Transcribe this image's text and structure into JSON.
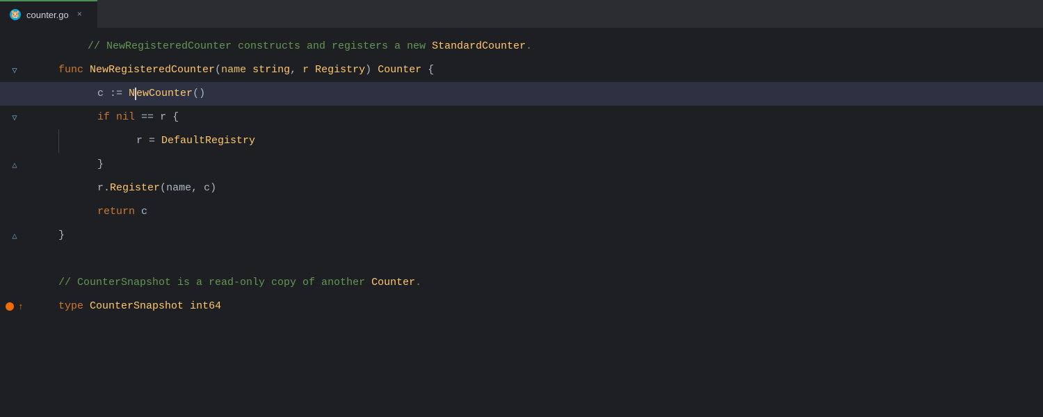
{
  "tab": {
    "icon": "🐹",
    "name": "counter.go",
    "close_label": "×"
  },
  "lines": [
    {
      "id": 1,
      "type": "comment",
      "has_fold": false,
      "fold_open": false,
      "indent": 0,
      "tokens": [
        {
          "t": "comment",
          "v": "// NewRegisteredCounter constructs and registers a new StandardCounter."
        }
      ]
    },
    {
      "id": 2,
      "type": "code",
      "has_fold": true,
      "fold_open": true,
      "indent": 0,
      "tokens": [
        {
          "t": "keyword",
          "v": "func "
        },
        {
          "t": "function",
          "v": "NewRegisteredCounter"
        },
        {
          "t": "paren",
          "v": "("
        },
        {
          "t": "param",
          "v": "name"
        },
        {
          "t": "plain",
          "v": " "
        },
        {
          "t": "type",
          "v": "string"
        },
        {
          "t": "plain",
          "v": ", "
        },
        {
          "t": "param",
          "v": "r"
        },
        {
          "t": "plain",
          "v": " "
        },
        {
          "t": "interface",
          "v": "Registry"
        },
        {
          "t": "paren",
          "v": ")"
        },
        {
          "t": "plain",
          "v": " "
        },
        {
          "t": "return_type",
          "v": "Counter"
        },
        {
          "t": "plain",
          "v": " {"
        }
      ]
    },
    {
      "id": 3,
      "type": "code",
      "has_fold": false,
      "fold_open": false,
      "indent": 2,
      "cursor": true,
      "tokens": [
        {
          "t": "var",
          "v": "c"
        },
        {
          "t": "plain",
          "v": " := "
        },
        {
          "t": "call",
          "v": "NewCounter"
        },
        {
          "t": "paren",
          "v": "()"
        }
      ]
    },
    {
      "id": 4,
      "type": "code",
      "has_fold": true,
      "fold_open": true,
      "indent": 2,
      "tokens": [
        {
          "t": "keyword",
          "v": "if"
        },
        {
          "t": "plain",
          "v": " "
        },
        {
          "t": "keyword",
          "v": "nil"
        },
        {
          "t": "plain",
          "v": " == "
        },
        {
          "t": "var",
          "v": "r"
        },
        {
          "t": "plain",
          "v": " {"
        }
      ]
    },
    {
      "id": 5,
      "type": "code",
      "has_fold": false,
      "fold_open": false,
      "indent": 4,
      "tokens": [
        {
          "t": "var",
          "v": "r"
        },
        {
          "t": "plain",
          "v": " = "
        },
        {
          "t": "highlight",
          "v": "DefaultRegistry"
        }
      ]
    },
    {
      "id": 6,
      "type": "code",
      "has_fold": true,
      "fold_open": true,
      "indent": 2,
      "tokens": [
        {
          "t": "plain",
          "v": "}"
        }
      ]
    },
    {
      "id": 7,
      "type": "code",
      "has_fold": false,
      "fold_open": false,
      "indent": 2,
      "tokens": [
        {
          "t": "var",
          "v": "r"
        },
        {
          "t": "plain",
          "v": "."
        },
        {
          "t": "call",
          "v": "Register"
        },
        {
          "t": "paren",
          "v": "("
        },
        {
          "t": "var",
          "v": "name"
        },
        {
          "t": "plain",
          "v": ", "
        },
        {
          "t": "var",
          "v": "c"
        },
        {
          "t": "paren",
          "v": ")"
        }
      ]
    },
    {
      "id": 8,
      "type": "code",
      "has_fold": false,
      "fold_open": false,
      "indent": 2,
      "tokens": [
        {
          "t": "keyword",
          "v": "return"
        },
        {
          "t": "plain",
          "v": " "
        },
        {
          "t": "var",
          "v": "c"
        }
      ]
    },
    {
      "id": 9,
      "type": "code",
      "has_fold": true,
      "fold_open": true,
      "indent": 0,
      "tokens": [
        {
          "t": "plain",
          "v": "}"
        }
      ]
    },
    {
      "id": 10,
      "type": "empty"
    },
    {
      "id": 11,
      "type": "comment",
      "has_fold": false,
      "fold_open": false,
      "indent": 0,
      "tokens": [
        {
          "t": "comment",
          "v": "// CounterSnapshot is a read-only copy of another Counter."
        }
      ]
    },
    {
      "id": 12,
      "type": "code",
      "has_fold": false,
      "fold_open": false,
      "indent": 0,
      "has_breakpoint": true,
      "tokens": [
        {
          "t": "keyword",
          "v": "type"
        },
        {
          "t": "plain",
          "v": " "
        },
        {
          "t": "type",
          "v": "CounterSnapshot"
        },
        {
          "t": "plain",
          "v": " "
        },
        {
          "t": "type",
          "v": "int64"
        }
      ]
    }
  ]
}
